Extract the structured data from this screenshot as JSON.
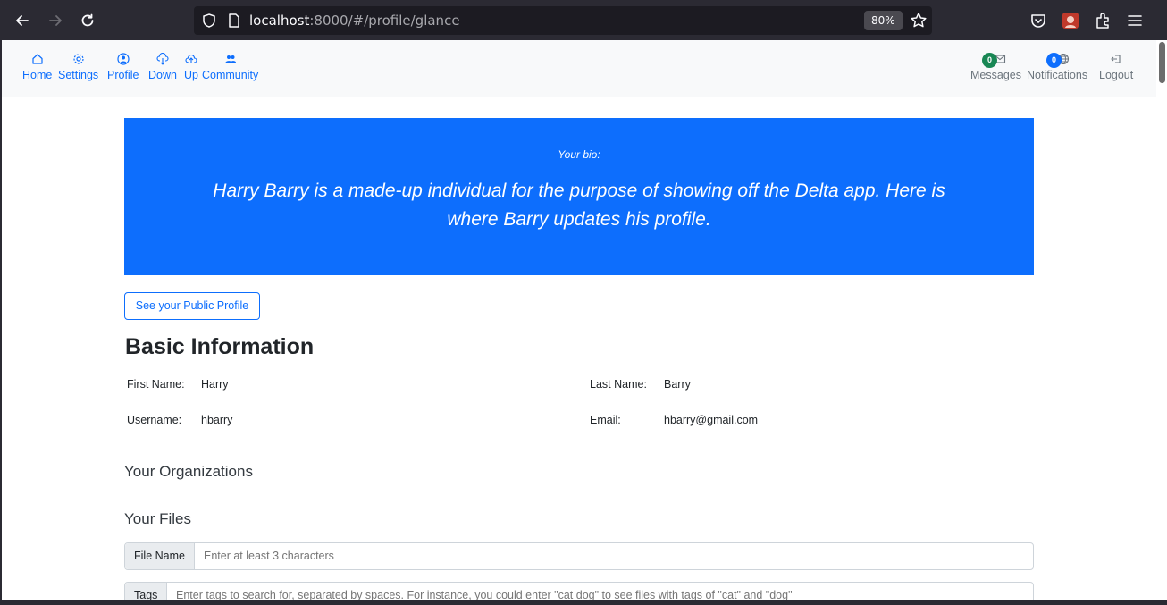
{
  "browser": {
    "url_host": "localhost",
    "url_path": ":8000/#/profile/glance",
    "zoom": "80%"
  },
  "nav": {
    "left": [
      {
        "label": "Home",
        "icon": "house-icon"
      },
      {
        "label": "Settings",
        "icon": "gear-icon"
      },
      {
        "label": "Profile",
        "icon": "person-circle-icon"
      },
      {
        "label": "Down",
        "icon": "cloud-download-icon"
      },
      {
        "label": "Up",
        "icon": "cloud-upload-icon"
      },
      {
        "label": "Community",
        "icon": "people-icon"
      }
    ],
    "messages": {
      "label": "Messages",
      "count": "0"
    },
    "notifications": {
      "label": "Notifications",
      "count": "0"
    },
    "logout": {
      "label": "Logout"
    }
  },
  "bio": {
    "label": "Your bio:",
    "text": "Harry Barry is a made-up individual for the purpose of showing off the Delta app. Here is where Barry updates his profile."
  },
  "public_profile_button": "See your Public Profile",
  "basic_info": {
    "title": "Basic Information",
    "first_name_label": "First Name:",
    "first_name": "Harry",
    "last_name_label": "Last Name:",
    "last_name": "Barry",
    "username_label": "Username:",
    "username": "hbarry",
    "email_label": "Email:",
    "email": "hbarry@gmail.com"
  },
  "organizations": {
    "title": "Your Organizations"
  },
  "files": {
    "title": "Your Files",
    "file_name_label": "File Name",
    "file_name_placeholder": "Enter at least 3 characters",
    "tags_label": "Tags",
    "tags_placeholder": "Enter tags to search for, separated by spaces. For instance, you could enter \"cat dog\" to see files with tags of \"cat\" and \"dog\""
  },
  "colors": {
    "primary": "#0d6efd",
    "success": "#198754",
    "browser_chrome": "#2b2a33"
  }
}
